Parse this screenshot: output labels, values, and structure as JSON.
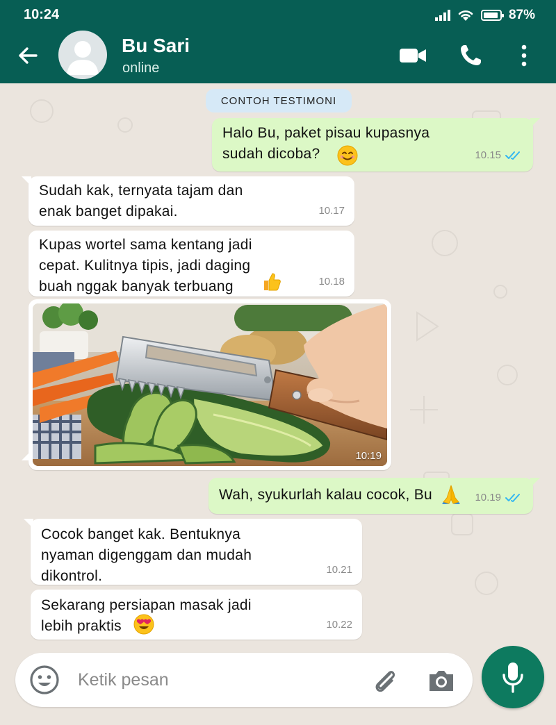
{
  "status_bar": {
    "time": "10:24",
    "battery": "87%"
  },
  "header": {
    "contact_name": "Bu Sari",
    "contact_status": "online"
  },
  "label_chip": "CONTOH TESTIMONI",
  "messages": [
    {
      "dir": "out",
      "text": "Halo Bu, paket pisau kupasnya\nsudah dicoba?",
      "time": "10.15",
      "read": true,
      "emoji": "smiling-face"
    },
    {
      "dir": "in",
      "text": "Sudah kak, ternyata tajam dan\nenak banget dipakai.",
      "time": "10.17"
    },
    {
      "dir": "in",
      "text": "Kupas wortel sama kentang jadi\ncepat. Kulitnya tipis, jadi daging\nbuah nggak banyak terbuang",
      "time": "10.18",
      "emoji": "thumbs-up"
    },
    {
      "dir": "in",
      "type": "image",
      "time": "10:19",
      "image": "vegetable-peeler-cucumber-photo"
    },
    {
      "dir": "out",
      "text": "Wah, syukurlah kalau cocok, Bu",
      "time": "10.19",
      "read": true,
      "emoji": "folded-hands"
    },
    {
      "dir": "in",
      "text": "Cocok banget kak. Bentuknya\nnyaman digenggam dan mudah\ndikontrol.",
      "time": "10.21"
    },
    {
      "dir": "in",
      "text": "Sekarang persiapan masak jadi\nlebih praktis",
      "time": "10.22",
      "emoji": "heart-eyes"
    }
  ],
  "composer": {
    "placeholder": "Ketik pesan"
  },
  "colors": {
    "header": "#075e54",
    "outgoing": "#dcf8c6",
    "incoming": "#ffffff",
    "read_ticks": "#34b7f1",
    "mic": "#0d7a5f",
    "chip": "#d6e9f7"
  }
}
